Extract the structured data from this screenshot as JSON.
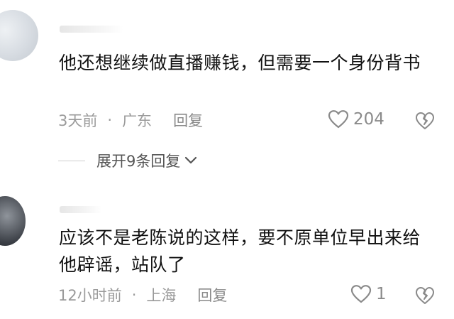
{
  "comments": [
    {
      "text": "他还想继续做直播赚钱，但需要一个身份背书",
      "time": "3天前",
      "separator": "·",
      "location": "广东",
      "reply_label": "回复",
      "likes": "204",
      "expand_label": "展开9条回复"
    },
    {
      "text": "应该不是老陈说的这样，要不原单位早出来给他辟谣，站队了",
      "time": "12小时前",
      "separator": "·",
      "location": "上海",
      "reply_label": "回复",
      "likes": "1"
    }
  ],
  "colors": {
    "meta": "#9a9a9a",
    "text": "#111111",
    "icon": "#8a8a8a"
  },
  "icons": [
    "heart-outline-icon",
    "broken-heart-icon",
    "chevron-down-icon"
  ]
}
